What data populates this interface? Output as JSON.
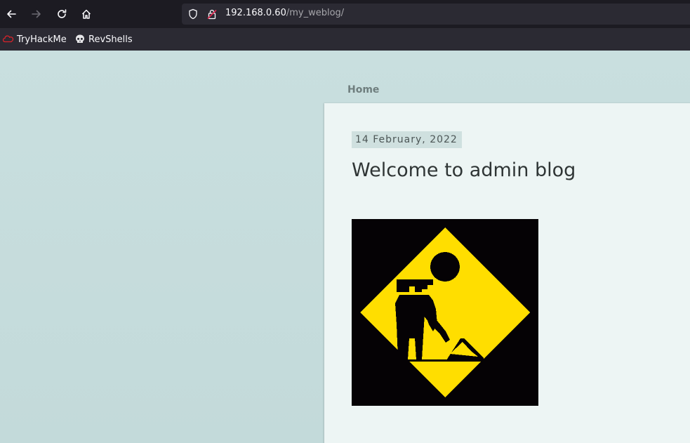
{
  "browser": {
    "url_host": "192.168.0.60",
    "url_path": "/my_weblog/",
    "bookmarks": [
      {
        "label": "TryHackMe",
        "icon": "tryhackme-icon"
      },
      {
        "label": "RevShells",
        "icon": "skull-icon"
      }
    ]
  },
  "page": {
    "nav": {
      "home_label": "Home"
    },
    "post": {
      "date": "14 February, 2022",
      "title": "Welcome to admin blog",
      "image_icon": "under-construction-sign-icon"
    }
  },
  "colors": {
    "toolbar_bg": "#1c1b22",
    "urlbar_bg": "#2b2a33",
    "page_bg": "#c6dcdc",
    "card_bg": "#edf5f4",
    "sign_yellow": "#ffde00",
    "sign_black": "#050205"
  }
}
